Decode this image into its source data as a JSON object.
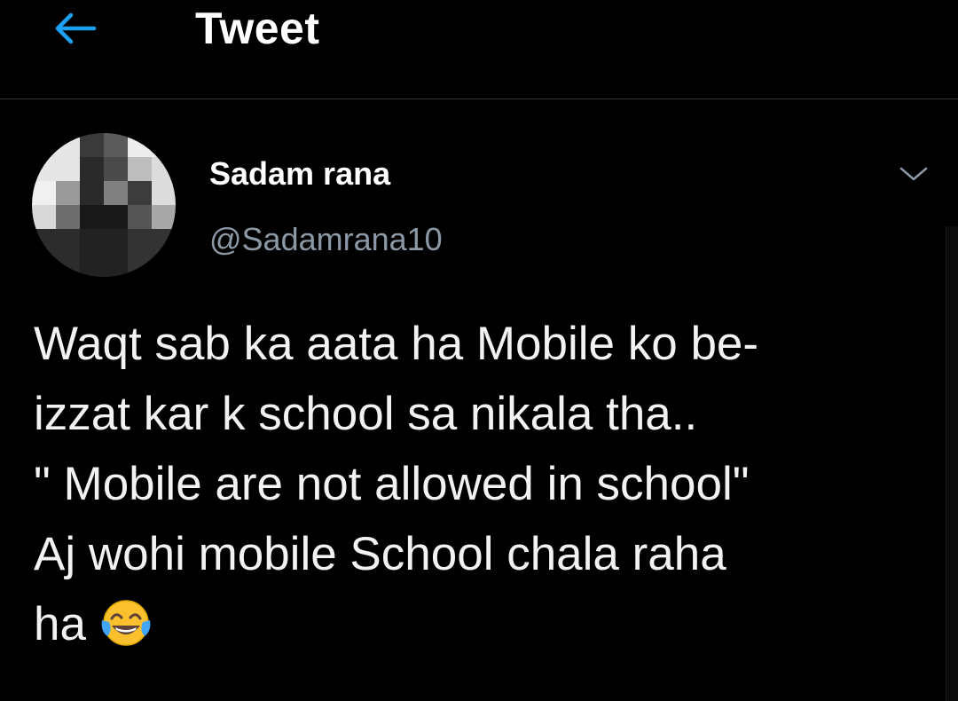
{
  "header": {
    "title": "Tweet",
    "back_icon": "arrow-left-icon",
    "accent_color": "#1da1f2"
  },
  "author": {
    "name": "Sadam rana",
    "handle": "@Sadamrana10",
    "avatar": "pixelated-profile-photo"
  },
  "menu": {
    "icon": "chevron-down-icon"
  },
  "tweet": {
    "lines": [
      "Waqt sab ka aata ha Mobile ko be-",
      "izzat kar k school sa nikala tha..",
      "\" Mobile are not allowed in school\"",
      "Aj wohi mobile School chala raha",
      "ha"
    ],
    "emoji": "face-with-tears-of-joy-icon"
  },
  "colors": {
    "background": "#000000",
    "text": "#f2f2f2",
    "secondary_text": "#8b98a5",
    "divider": "#2f3336"
  }
}
